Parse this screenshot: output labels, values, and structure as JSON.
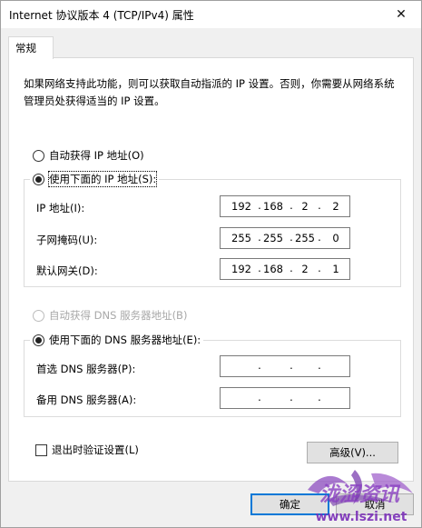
{
  "window": {
    "title": "Internet 协议版本 4 (TCP/IPv4) 属性",
    "close_glyph": "✕"
  },
  "tabs": [
    "常规"
  ],
  "description": "如果网络支持此功能，则可以获取自动指派的 IP 设置。否则，你需要从网络系统管理员处获得适当的 IP 设置。",
  "ip_mode": {
    "auto_label": "自动获得 IP 地址(O)",
    "manual_label": "使用下面的 IP 地址(S):",
    "selected": "manual"
  },
  "ip_fields": [
    {
      "label": "IP 地址(I):",
      "octets": [
        "192",
        "168",
        "2",
        "2"
      ]
    },
    {
      "label": "子网掩码(U):",
      "octets": [
        "255",
        "255",
        "255",
        "0"
      ]
    },
    {
      "label": "默认网关(D):",
      "octets": [
        "192",
        "168",
        "2",
        "1"
      ]
    }
  ],
  "dns_mode": {
    "auto_label": "自动获得 DNS 服务器地址(B)",
    "manual_label": "使用下面的 DNS 服务器地址(E):",
    "selected": "manual",
    "auto_disabled": true
  },
  "dns_fields": [
    {
      "label": "首选 DNS 服务器(P):",
      "octets": [
        "",
        "",
        "",
        ""
      ]
    },
    {
      "label": "备用 DNS 服务器(A):",
      "octets": [
        "",
        "",
        "",
        ""
      ]
    }
  ],
  "validate_on_exit": {
    "label": "退出时验证设置(L)",
    "checked": false
  },
  "buttons": {
    "advanced": "高级(V)...",
    "ok": "确定",
    "cancel": "取消"
  },
  "watermark": {
    "text": "泷涩资讯",
    "url_text": "www.lszi.net"
  }
}
